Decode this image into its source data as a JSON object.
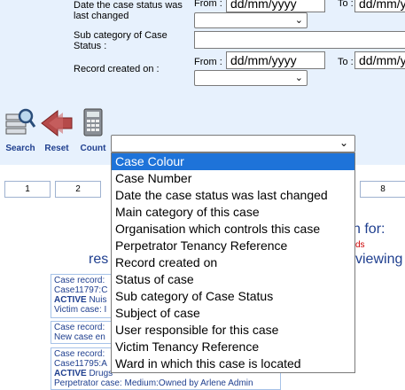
{
  "filters": {
    "status_changed_label": "Date the case status was last changed",
    "from_label": "From :",
    "to_label": "To :",
    "date_placeholder": "dd/mm/yyyy",
    "subcategory_label": "Sub category of Case Status :",
    "record_created_label": "Record created on :"
  },
  "toolbar": {
    "search_label": "Search",
    "reset_label": "Reset",
    "count_label": "Count"
  },
  "pager": {
    "page_1": "1",
    "page_2": "2",
    "page_8": "8"
  },
  "results": {
    "heading_right": "n for:",
    "line2_left": "res",
    "line2_right": "viewing",
    "red_fragment": "ds",
    "cases": [
      {
        "line1": "Case record:",
        "line2": "Case11797:C",
        "status": "ACTIVE",
        "status_rest": " Nuis",
        "line4": "Victim case: I"
      },
      {
        "line1": "Case record:",
        "line2": "New case en"
      },
      {
        "line1": "Case record:",
        "line2": "Case11795:A",
        "status": "ACTIVE",
        "status_rest": " Drugs",
        "line4": "Perpetrator case: Medium:Owned by Arlene Admin"
      }
    ]
  },
  "sort_dropdown": {
    "selected_value": "",
    "options": [
      "Case Colour",
      "Case Number",
      "Date the case status was last changed",
      "Main category of this case",
      "Organisation which controls this case",
      "Perpetrator Tenancy Reference",
      "Record created on",
      "Status of case",
      "Sub category of Case Status",
      "Subject of case",
      "User responsible for this case",
      "Victim Tenancy Reference",
      "Ward in which this case is located"
    ],
    "highlighted_index": 0
  },
  "colors": {
    "panel_bg": "#e7f1fd",
    "highlight": "#1e73d9",
    "link_blue": "#1f3f8f",
    "red": "#cc0000"
  }
}
